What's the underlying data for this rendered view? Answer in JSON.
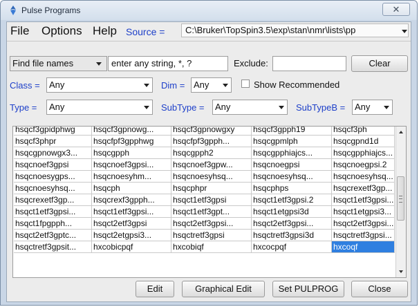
{
  "window": {
    "title": "Pulse Programs",
    "close_glyph": "✕",
    "icon": "pulse-program-icon"
  },
  "menu": [
    "File",
    "Options",
    "Help"
  ],
  "source": {
    "label": "Source =",
    "value": "C:\\Bruker\\TopSpin3.5\\exp\\stan\\nmr\\lists\\pp"
  },
  "search": {
    "mode": "Find file names",
    "pattern": "enter any string, *, ?",
    "exclude_label": "Exclude:",
    "exclude_value": "",
    "clear_label": "Clear"
  },
  "filters": {
    "class_label": "Class =",
    "class_value": "Any",
    "dim_label": "Dim =",
    "dim_value": "Any",
    "show_recommended_label": "Show Recommended",
    "show_recommended_checked": false,
    "type_label": "Type =",
    "type_value": "Any",
    "subtype_label": "SubType =",
    "subtype_value": "Any",
    "subtypeb_label": "SubTypeB =",
    "subtypeb_value": "Any"
  },
  "programs": [
    [
      "hsqcf3gpidphwg",
      "hsqcf3gpnowg...",
      "hsqcf3gpnowgxy",
      "hsqcf3gpph19",
      "hsqcf3ph"
    ],
    [
      "hsqcf3phpr",
      "hsqcfpf3gpphwg",
      "hsqcfpf3gpph...",
      "hsqcgpmlph",
      "hsqcgpnd1d"
    ],
    [
      "hsqcgpnowgx3...",
      "hsqcgpph",
      "hsqcgpph2",
      "hsqcgpphiajcs...",
      "hsqcgpphiajcs..."
    ],
    [
      "hsqcnoef3gpsi",
      "hsqcnoef3gpsi...",
      "hsqcnoef3gpw...",
      "hsqcnoegpsi",
      "hsqcnoegpsi.2"
    ],
    [
      "hsqcnoesygps...",
      "hsqcnoesyhm...",
      "hsqcnoesyhsq...",
      "hsqcnoesyhsq...",
      "hsqcnoesyhsq..."
    ],
    [
      "hsqcnoesyhsq...",
      "hsqcph",
      "hsqcphpr",
      "hsqcphps",
      "hsqcrexetf3gp..."
    ],
    [
      "hsqcrexetf3gp...",
      "hsqcrexf3gpph...",
      "hsqct1etf3gpsi",
      "hsqct1etf3gpsi.2",
      "hsqct1etf3gpsi..."
    ],
    [
      "hsqct1etf3gpsi...",
      "hsqct1etf3gpsi...",
      "hsqct1etf3gpt...",
      "hsqct1etgpsi3d",
      "hsqct1etgpsi3..."
    ],
    [
      "hsqct1fpgpph...",
      "hsqct2etf3gpsi",
      "hsqct2etf3gpsi...",
      "hsqct2etf3gpsi...",
      "hsqct2etf3gpsi..."
    ],
    [
      "hsqct2etf3gptc...",
      "hsqct2etgpsi3...",
      "hsqctretf3gpsi",
      "hsqctretf3gpsi3d",
      "hsqctretf3gpsi..."
    ],
    [
      "hsqctretf3gpsit...",
      "hxcobicpqf",
      "hxcobiqf",
      "hxcocpqf",
      "hxcoqf"
    ]
  ],
  "selected": "hxcoqf",
  "buttons": {
    "edit": "Edit",
    "graphical_edit": "Graphical Edit",
    "set_pulprog": "Set PULPROG",
    "close": "Close"
  }
}
